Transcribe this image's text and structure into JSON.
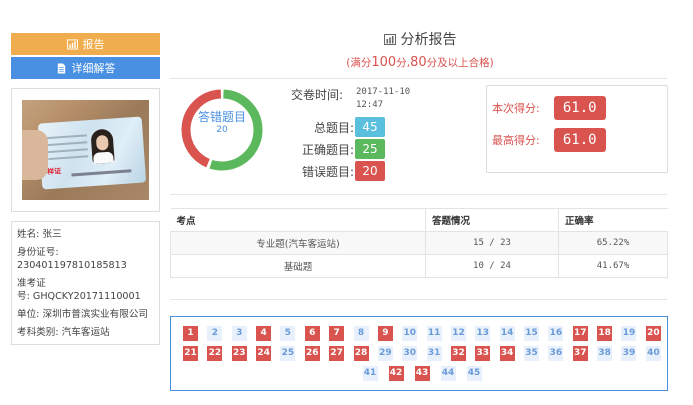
{
  "sidebar": {
    "report_button": "报告",
    "detail_button": "详细解答",
    "photo_stamp": "样证",
    "info": [
      {
        "label": "姓名:",
        "value": "张三"
      },
      {
        "label": "身份证号:",
        "value": "230401197810185813"
      },
      {
        "label": "准考证号:",
        "value": "GHQCKY20171110001"
      },
      {
        "label": "单位:",
        "value": "深圳市普滨实业有限公司"
      },
      {
        "label": "考科类别:",
        "value": "汽车客运站"
      }
    ]
  },
  "header": {
    "title": "分析报告",
    "subtitle_prefix": "(满分",
    "full_score": "100",
    "subtitle_mid": "分,",
    "pass_score": "80",
    "subtitle_suffix": "分及以上合格)"
  },
  "donut": {
    "label": "答错题目",
    "count": "20",
    "wrong_fraction": 0.444,
    "colors": {
      "wrong": "#d9534f",
      "right": "#5cb85c"
    }
  },
  "stats": {
    "submit_time_label": "交卷时间:",
    "submit_date": "2017-11-10",
    "submit_clock": "12:47",
    "total_label": "总题目:",
    "total": "45",
    "correct_label": "正确题目:",
    "correct": "25",
    "wrong_label": "错误题目:",
    "wrong": "20"
  },
  "scores": {
    "current_label": "本次得分:",
    "current": "61.0",
    "best_label": "最高得分:",
    "best": "61.0"
  },
  "table": {
    "headers": [
      "考点",
      "答题情况",
      "正确率"
    ],
    "rows": [
      {
        "topic": "专业题(汽车客运站)",
        "answers": "15 / 23",
        "rate": "65.22%"
      },
      {
        "topic": "基础题",
        "answers": "10 / 24",
        "rate": "41.67%"
      }
    ]
  },
  "questions": {
    "wrong": [
      1,
      4,
      6,
      7,
      9,
      17,
      18,
      20,
      21,
      22,
      23,
      24,
      26,
      27,
      28,
      32,
      33,
      34,
      37,
      42,
      43
    ],
    "rows": [
      [
        1,
        2,
        3,
        4,
        5,
        6,
        7,
        8,
        9,
        10,
        11,
        12,
        13,
        14,
        15,
        16,
        17,
        18,
        19,
        20
      ],
      [
        21,
        22,
        23,
        24,
        25,
        26,
        27,
        28,
        29,
        30,
        31,
        32,
        33,
        34,
        35,
        36,
        37,
        38,
        39,
        40
      ],
      [
        41,
        42,
        43,
        44,
        45
      ]
    ]
  }
}
